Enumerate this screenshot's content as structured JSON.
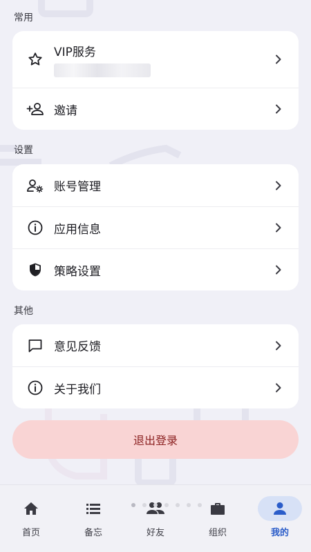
{
  "sections": {
    "common": {
      "title": "常用",
      "items": [
        {
          "label": "VIP服务",
          "icon": "star-icon"
        },
        {
          "label": "邀请",
          "icon": "person-add-icon"
        }
      ]
    },
    "settings": {
      "title": "设置",
      "items": [
        {
          "label": "账号管理",
          "icon": "account-settings-icon"
        },
        {
          "label": "应用信息",
          "icon": "info-icon"
        },
        {
          "label": "策略设置",
          "icon": "shield-icon"
        }
      ]
    },
    "other": {
      "title": "其他",
      "items": [
        {
          "label": "意见反馈",
          "icon": "feedback-icon"
        },
        {
          "label": "关于我们",
          "icon": "info-icon"
        }
      ]
    }
  },
  "logout_label": "退出登录",
  "tabs": [
    {
      "label": "首页",
      "icon": "home-icon",
      "active": false
    },
    {
      "label": "备忘",
      "icon": "list-icon",
      "active": false
    },
    {
      "label": "好友",
      "icon": "people-icon",
      "active": false
    },
    {
      "label": "组织",
      "icon": "briefcase-icon",
      "active": false
    },
    {
      "label": "我的",
      "icon": "person-icon",
      "active": true
    }
  ],
  "colors": {
    "accent": "#2a5cc9",
    "logout_bg": "#f9d4d4",
    "logout_text": "#8a1f1f",
    "page_bg": "#f0f0f7"
  }
}
